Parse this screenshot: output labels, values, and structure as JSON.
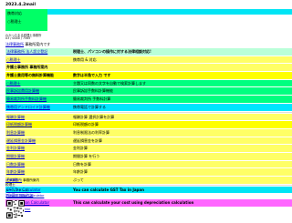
{
  "header": {
    "date": "2023.4.2mail",
    "green_line1": "携帯対応",
    "green_line2": "○税理士",
    "office_name": "わかったまる税理士事務所",
    "office_phone": "03 / 0000 / 7565",
    "office_link": "法律事務所",
    "office_tagline": "事務所案内です"
  },
  "rows": [
    {
      "left": "法律事務所 法人設立登記",
      "right": "税理士、パソコンの操作に対する法律相談対応!",
      "lbg": "#b9ffd9",
      "rbg": "#b9ffd9",
      "lstyle": "link",
      "rstyle": "bold"
    },
    {
      "left": "○税理士",
      "right": "携帯用 & 対応",
      "lbg": "#ffff66",
      "rbg": "#ffff66",
      "lstyle": "link",
      "rstyle": ""
    },
    {
      "left": "弁護士事務所 事務所案内",
      "right": "",
      "lbg": "#ffff66",
      "rbg": "#ffff66",
      "lstyle": "bold",
      "rstyle": ""
    },
    {
      "left": "弁護士費用等の無料計算機能",
      "right": "数字は半角で入力 です",
      "lbg": "#ffff00",
      "rbg": "#ffff00",
      "lstyle": "bold",
      "rstyle": "bold"
    },
    {
      "left": "○税理士",
      "right": "主題又は同数の文字を自動で検索計算します",
      "lbg": "#00ff80",
      "rbg": "#00ff80",
      "lstyle": "link",
      "rstyle": ""
    },
    {
      "left": "民事訴訟費用計算機",
      "right": "民事訴訟手数料計算機能",
      "lbg": "#00ff80",
      "rbg": "#00ff80",
      "lstyle": "link",
      "rstyle": ""
    },
    {
      "left": "簡易裁判所手数料計算機",
      "right": "簡易裁判所 手数料計算",
      "lbg": "#00ff80",
      "rbg": "#00ff80",
      "lstyle": "link",
      "rstyle": ""
    },
    {
      "left": "携帯用アンドロイド計算機",
      "right": "携帯電話で計算する",
      "lbg": "#00e5ff",
      "rbg": "#00e5ff",
      "lstyle": "link",
      "rstyle": ""
    },
    {
      "left": "報酬計算機",
      "right": "報酬計算 選択計算を計算",
      "lbg": "#ffff66",
      "rbg": "#ffff66",
      "lstyle": "link",
      "rstyle": ""
    },
    {
      "left": "印紙税額計算機",
      "right": "印紙税額の計算",
      "lbg": "#ffff00",
      "rbg": "#ffff00",
      "lstyle": "link",
      "rstyle": ""
    },
    {
      "left": "利息計算機",
      "right": "利息制限法の利率計算",
      "lbg": "#ffff66",
      "rbg": "#ffff66",
      "lstyle": "link",
      "rstyle": ""
    },
    {
      "left": "遅延損害金計算機",
      "right": "遅延損害金を計算",
      "lbg": "#ffff66",
      "rbg": "#ffff66",
      "lstyle": "link",
      "rstyle": ""
    },
    {
      "left": "金利計算機",
      "right": "金利計算",
      "lbg": "#ffff66",
      "rbg": "#ffff66",
      "lstyle": "link",
      "rstyle": ""
    },
    {
      "left": "期間計算機",
      "right": "期間計算 を行う",
      "lbg": "#ffff66",
      "rbg": "#ffff66",
      "lstyle": "link",
      "rstyle": ""
    },
    {
      "left": "日数計算機",
      "right": "日数を計算",
      "lbg": "#ffff66",
      "rbg": "#ffff66",
      "lstyle": "link",
      "rstyle": ""
    },
    {
      "left": "年齢計算機",
      "right": "年齢計算",
      "lbg": "#ffff66",
      "rbg": "#ffff66",
      "lstyle": "link",
      "rstyle": ""
    },
    {
      "left": "その他",
      "right": "ぶって",
      "lbg": "#ffff66",
      "rbg": "#ffff66",
      "lstyle": "link",
      "rstyle": ""
    },
    {
      "left": "GST Tax Calculator",
      "right": "You can calculate GST Tax in Japan",
      "lbg": "#00e5f5",
      "rbg": "#00e5f5",
      "lstyle": "link",
      "rstyle": "bold"
    },
    {
      "left": "Present Value Calculator",
      "right": "",
      "lbg": "#ffffff",
      "rbg": "#ffffff",
      "lstyle": "link",
      "rstyle": ""
    },
    {
      "left": "Depreciation Calculator",
      "right": "This can calculate your cost using depreciation calculation",
      "lbg": "#ff66ff",
      "rbg": "#ff66ff",
      "lstyle": "link",
      "rstyle": "bold"
    },
    {
      "left": "Loan Calculator",
      "right": "",
      "lbg": "#ffffff",
      "rbg": "#ffffff",
      "lstyle": "link",
      "rstyle": ""
    }
  ],
  "footer": {
    "link": "法律事務所",
    "desc": "事務所案内",
    "line2": "税理士",
    "line3": "メールアドレス",
    "email": "info@example.jp"
  }
}
